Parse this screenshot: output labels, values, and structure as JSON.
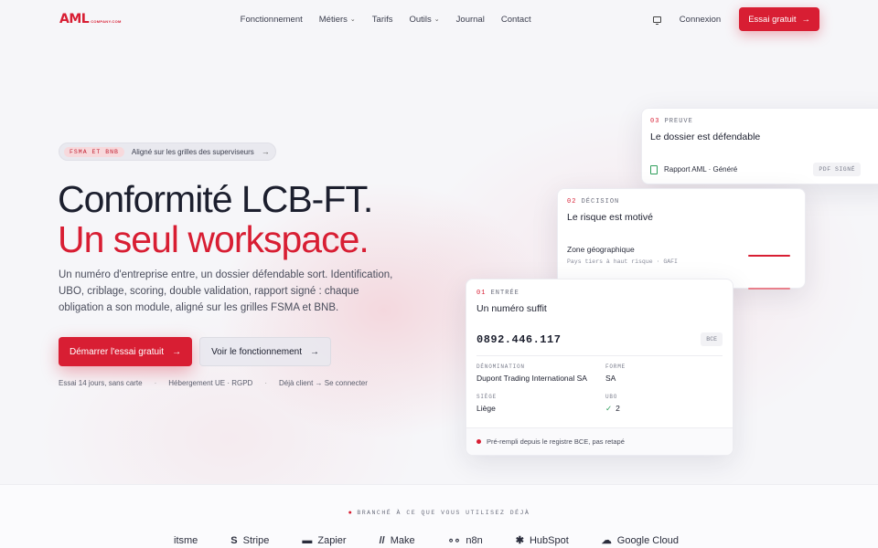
{
  "nav": {
    "logo_text": "AML",
    "logo_sub": "COMPANY.COM",
    "links": [
      "Fonctionnement",
      "Métiers",
      "Tarifs",
      "Outils",
      "Journal",
      "Contact"
    ],
    "login": "Connexion",
    "cta": "Essai gratuit"
  },
  "hero": {
    "badge_tag": "FSMA ET BNB",
    "badge_text": "Aligné sur les grilles des superviseurs",
    "title_line1": "Conformité LCB-FT.",
    "title_line2": "Un seul workspace.",
    "lead": "Un numéro d'entreprise entre, un dossier défendable sort. Identification, UBO, criblage, scoring, double validation, rapport signé : chaque obligation a son module, aligné sur les grilles FSMA et BNB.",
    "cta_primary": "Démarrer l'essai gratuit",
    "cta_secondary": "Voir le fonctionnement",
    "meta": [
      "Essai 14 jours, sans carte",
      "Hébergement UE · RGPD",
      "Déjà client → Se connecter"
    ]
  },
  "card_proof": {
    "num": "03",
    "kicker": "PREUVE",
    "title": "Le dossier est défendable",
    "row_label": "Rapport AML · Généré",
    "tag": "PDF SIGNÉ"
  },
  "card_decision": {
    "num": "02",
    "kicker": "DÉCISION",
    "title": "Le risque est motivé",
    "label": "Zone géographique",
    "sub": "Pays tiers à haut risque · GAFI"
  },
  "card_entry": {
    "num": "01",
    "kicker": "ENTRÉE",
    "title": "Un numéro suffit",
    "number": "0892.446.117",
    "tag": "BCE",
    "fields": {
      "denomination_label": "DÉNOMINATION",
      "denomination": "Dupont Trading International SA",
      "forme_label": "FORME",
      "forme": "SA",
      "siege_label": "SIÈGE",
      "siege": "Liège",
      "ubo_label": "UBO",
      "ubo": "2"
    },
    "footer": "Pré-rempli depuis le registre BCE, pas retapé"
  },
  "integrations": {
    "kicker": "BRANCHÉ À CE QUE VOUS UTILISEZ DÉJÀ",
    "logos": [
      "itsme",
      "Stripe",
      "Zapier",
      "Make",
      "n8n",
      "HubSpot",
      "Google Cloud"
    ]
  },
  "colors": {
    "brand": "#d81e33",
    "ok": "#2e9e5b"
  }
}
